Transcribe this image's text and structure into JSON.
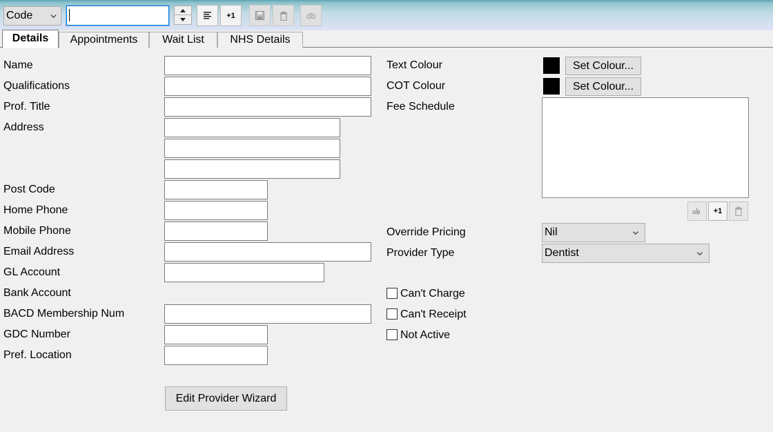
{
  "toolbar": {
    "combo_value": "Code",
    "search_value": "",
    "plus_one_label": "+1",
    "db_label": "db"
  },
  "tabs": [
    {
      "label": "Details",
      "active": true
    },
    {
      "label": "Appointments",
      "active": false
    },
    {
      "label": "Wait List",
      "active": false
    },
    {
      "label": "NHS Details",
      "active": false
    }
  ],
  "labels": {
    "name": "Name",
    "qualifications": "Qualifications",
    "prof_title": "Prof. Title",
    "address": "Address",
    "post_code": "Post Code",
    "home_phone": "Home Phone",
    "mobile_phone": "Mobile Phone",
    "email_address": "Email Address",
    "gl_account": "GL Account",
    "bank_account": "Bank Account",
    "bacd_membership": "BACD Membership Num",
    "gdc_number": "GDC Number",
    "pref_location": "Pref. Location",
    "text_colour": "Text Colour",
    "cot_colour": "COT Colour",
    "fee_schedule": "Fee Schedule",
    "override_pricing": "Override Pricing",
    "provider_type": "Provider Type"
  },
  "fields": {
    "name": "",
    "qualifications": "",
    "prof_title": "",
    "address_1": "",
    "address_2": "",
    "address_3": "",
    "post_code": "",
    "home_phone": "",
    "mobile_phone": "",
    "email_address": "",
    "gl_account": "",
    "bacd_membership": "",
    "gdc_number": "",
    "pref_location": ""
  },
  "buttons": {
    "set_colour": "Set Colour...",
    "edit_provider_wizard": "Edit Provider Wizard",
    "fee_plus_one": "+1"
  },
  "dropdowns": {
    "override_pricing": "Nil",
    "provider_type": "Dentist"
  },
  "checkboxes": [
    {
      "label": "Can't Charge",
      "checked": false
    },
    {
      "label": "Can't Receipt",
      "checked": false
    },
    {
      "label": "Not Active",
      "checked": false
    }
  ],
  "colors": {
    "text_colour": "#000000",
    "cot_colour": "#000000"
  }
}
